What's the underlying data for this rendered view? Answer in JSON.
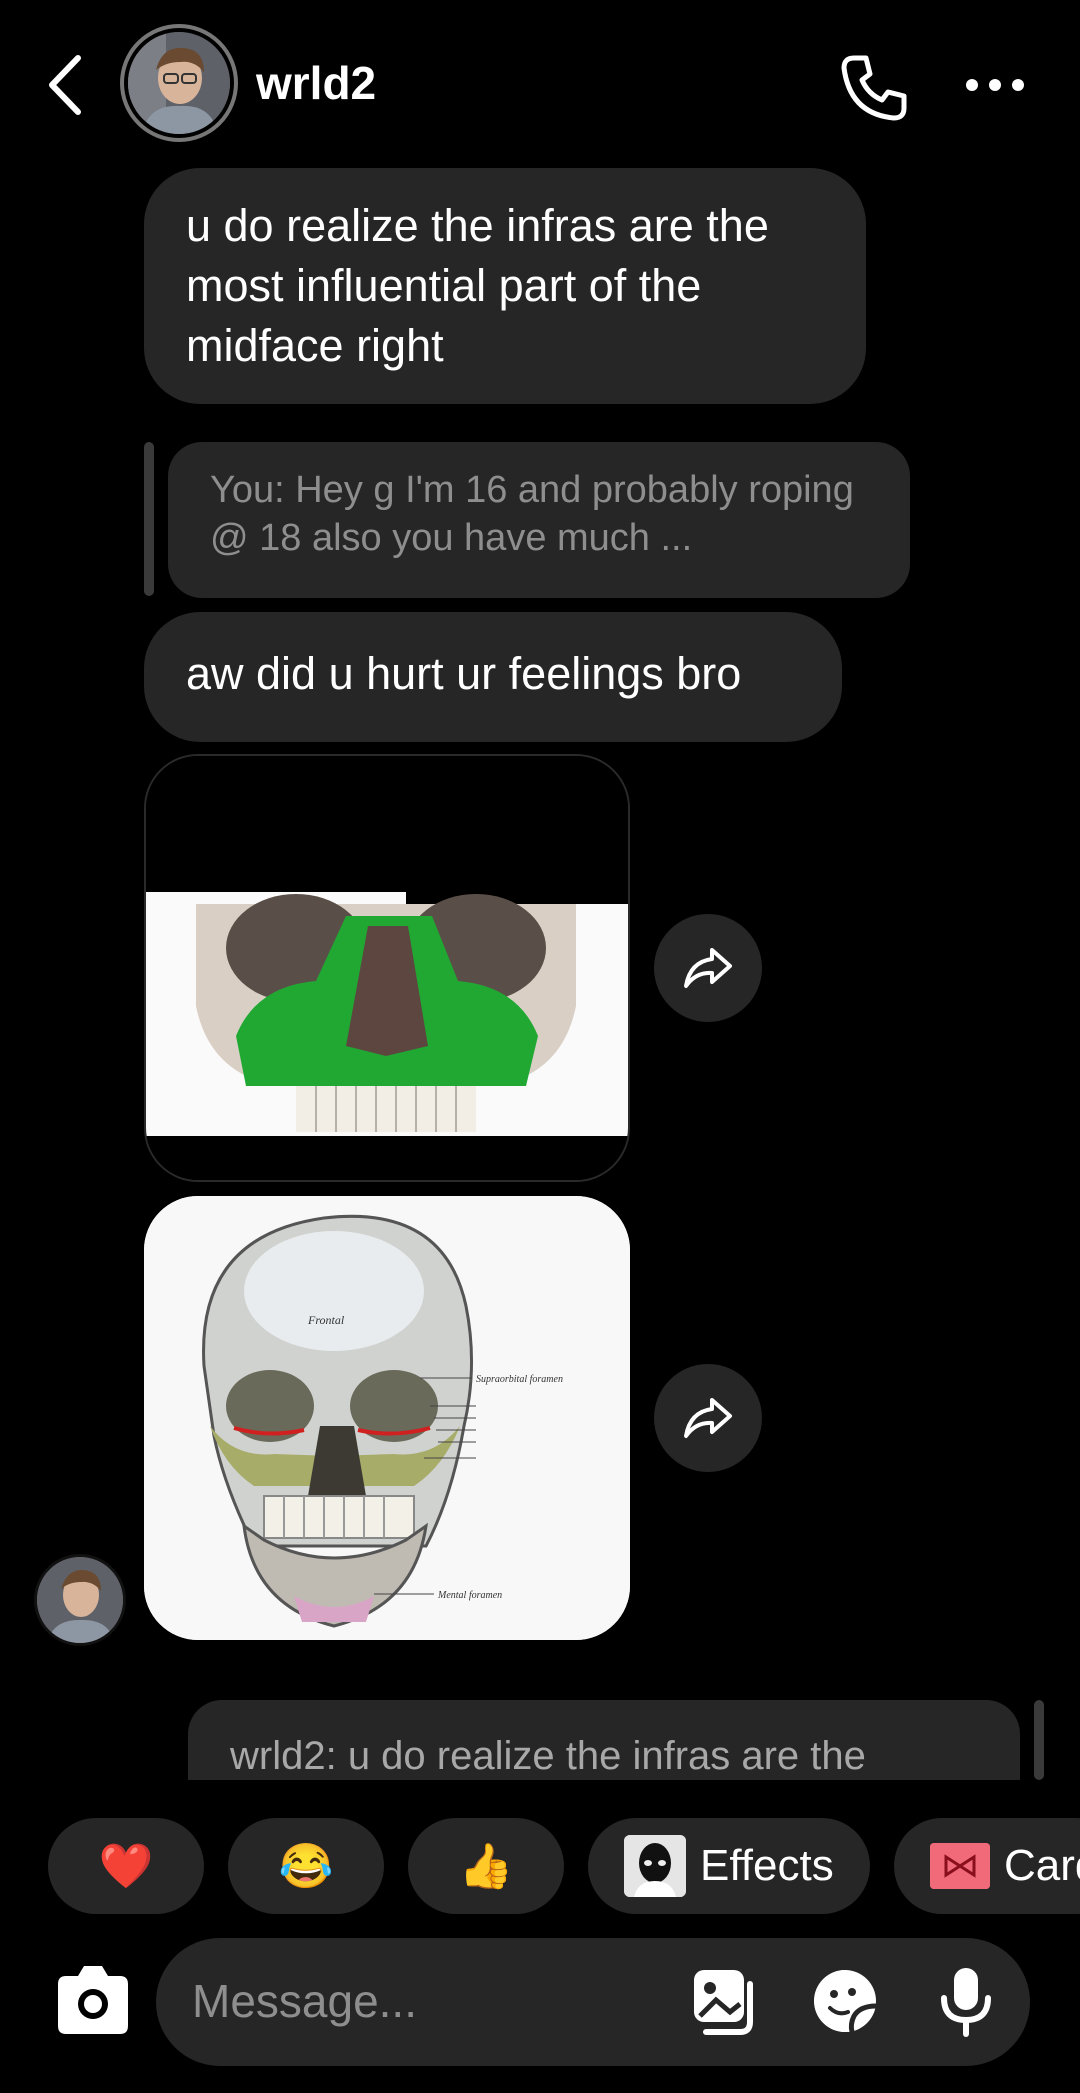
{
  "header": {
    "username": "wrld2"
  },
  "messages": {
    "m1": "u do realize the infras are the most influential part of the midface right",
    "reply_quote": "You: Hey g I'm 16 and probably roping @ 18 also you have much ...",
    "m2": "aw did u hurt ur feelings bro",
    "reply_preview": "wrld2: u do realize the infras are the"
  },
  "quick_reactions": {
    "heart": "❤️",
    "laugh": "😂",
    "thumbs": "👍",
    "effects_label": "Effects",
    "card_label": "Card"
  },
  "composer": {
    "placeholder": "Message..."
  },
  "skull_labels": {
    "frontal": "Frontal",
    "supraorbital": "Supraorbital foramen",
    "mental": "Mental foramen"
  },
  "colors": {
    "background": "#000000",
    "bubble": "#262626",
    "muted_text": "#8e8e8e",
    "maxilla_highlight": "#21a833"
  }
}
